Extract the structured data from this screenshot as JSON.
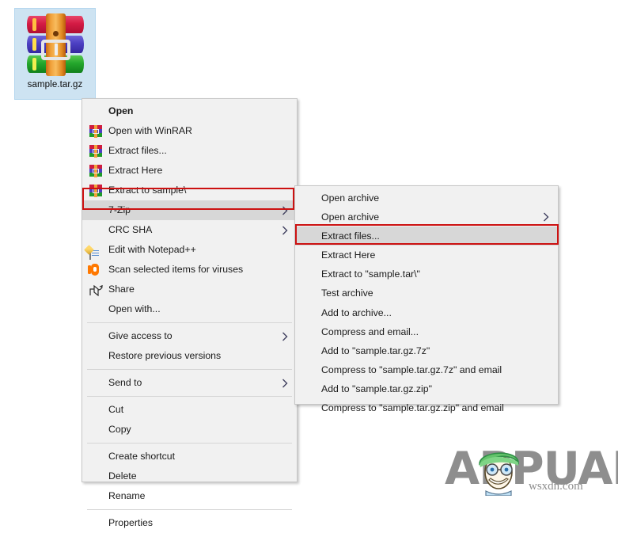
{
  "desktop": {
    "icon": {
      "name": "sample.tar.gz",
      "icon_semantic": "winrar-archive-icon",
      "selected": true,
      "selection_color": "#cde3f2"
    }
  },
  "context_menu": {
    "name": "file-context-menu",
    "items": [
      {
        "label": "Open",
        "icon": "none",
        "bold": true,
        "submenu": false,
        "separator_after": false
      },
      {
        "label": "Open with WinRAR",
        "icon": "winrar-icon",
        "bold": false,
        "submenu": false,
        "separator_after": false
      },
      {
        "label": "Extract files...",
        "icon": "winrar-icon",
        "bold": false,
        "submenu": false,
        "separator_after": false
      },
      {
        "label": "Extract Here",
        "icon": "winrar-icon",
        "bold": false,
        "submenu": false,
        "separator_after": false
      },
      {
        "label": "Extract to sample\\",
        "icon": "winrar-icon",
        "bold": false,
        "submenu": false,
        "separator_after": false
      },
      {
        "label": "7-Zip",
        "icon": "none",
        "bold": false,
        "submenu": true,
        "separator_after": false,
        "highlighted": true
      },
      {
        "label": "CRC SHA",
        "icon": "none",
        "bold": false,
        "submenu": true,
        "separator_after": false
      },
      {
        "label": "Edit with Notepad++",
        "icon": "notepad-plus-plus-icon",
        "bold": false,
        "submenu": false,
        "separator_after": false
      },
      {
        "label": "Scan selected items for viruses",
        "icon": "avast-shield-icon",
        "bold": false,
        "submenu": false,
        "separator_after": false
      },
      {
        "label": "Share",
        "icon": "share-icon",
        "bold": false,
        "submenu": false,
        "separator_after": false
      },
      {
        "label": "Open with...",
        "icon": "none",
        "bold": false,
        "submenu": false,
        "separator_after": true
      },
      {
        "label": "Give access to",
        "icon": "none",
        "bold": false,
        "submenu": true,
        "separator_after": false
      },
      {
        "label": "Restore previous versions",
        "icon": "none",
        "bold": false,
        "submenu": false,
        "separator_after": true
      },
      {
        "label": "Send to",
        "icon": "none",
        "bold": false,
        "submenu": true,
        "separator_after": true
      },
      {
        "label": "Cut",
        "icon": "none",
        "bold": false,
        "submenu": false,
        "separator_after": false
      },
      {
        "label": "Copy",
        "icon": "none",
        "bold": false,
        "submenu": false,
        "separator_after": true
      },
      {
        "label": "Create shortcut",
        "icon": "none",
        "bold": false,
        "submenu": false,
        "separator_after": false
      },
      {
        "label": "Delete",
        "icon": "none",
        "bold": false,
        "submenu": false,
        "separator_after": false
      },
      {
        "label": "Rename",
        "icon": "none",
        "bold": false,
        "submenu": false,
        "separator_after": true
      },
      {
        "label": "Properties",
        "icon": "none",
        "bold": false,
        "submenu": false,
        "separator_after": false
      }
    ]
  },
  "submenu": {
    "name": "7-zip-submenu",
    "items": [
      {
        "label": "Open archive",
        "submenu": false
      },
      {
        "label": "Open archive",
        "submenu": true
      },
      {
        "label": "Extract files...",
        "submenu": false,
        "highlighted": true
      },
      {
        "label": "Extract Here",
        "submenu": false
      },
      {
        "label": "Extract to \"sample.tar\\\"",
        "submenu": false
      },
      {
        "label": "Test archive",
        "submenu": false
      },
      {
        "label": "Add to archive...",
        "submenu": false
      },
      {
        "label": "Compress and email...",
        "submenu": false
      },
      {
        "label": "Add to \"sample.tar.gz.7z\"",
        "submenu": false
      },
      {
        "label": "Compress to \"sample.tar.gz.7z\" and email",
        "submenu": false
      },
      {
        "label": "Add to \"sample.tar.gz.zip\"",
        "submenu": false
      },
      {
        "label": "Compress to \"sample.tar.gz.zip\" and email",
        "submenu": false
      }
    ]
  },
  "annotations": {
    "highlight_color": "#cc1111",
    "boxes": [
      {
        "target": "7-Zip",
        "menu": "file-context-menu"
      },
      {
        "target": "Extract files...",
        "menu": "7-zip-submenu"
      }
    ]
  },
  "watermark": {
    "brand": "APPUALS",
    "brand_prefix": "A",
    "brand_suffix": "PPUALS",
    "brand_color": "#8e8e8e",
    "source": "wsxdn.com"
  }
}
